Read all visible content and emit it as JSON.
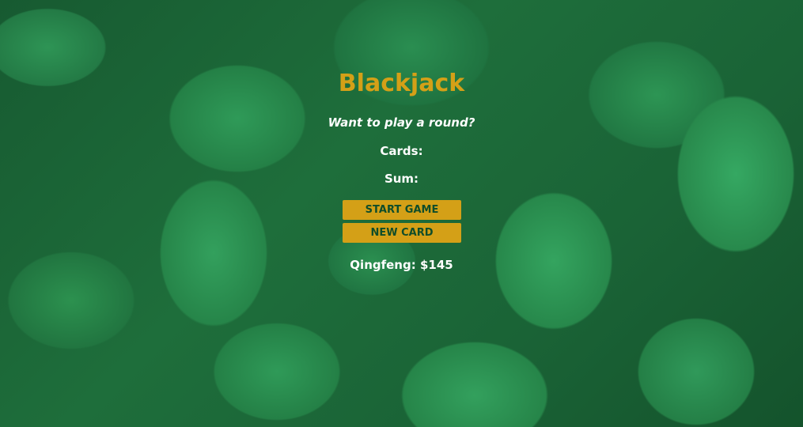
{
  "game": {
    "title": "Blackjack",
    "message": "Want to play a round?",
    "cards_label": "Cards:",
    "sum_label": "Sum:",
    "start_button": "START GAME",
    "new_card_button": "NEW CARD",
    "player_text": "Qingfeng: $145"
  },
  "colors": {
    "accent": "#d4a017",
    "text": "#ffffff",
    "button_text": "#0f4d2a",
    "background": "#1f6b3c"
  }
}
